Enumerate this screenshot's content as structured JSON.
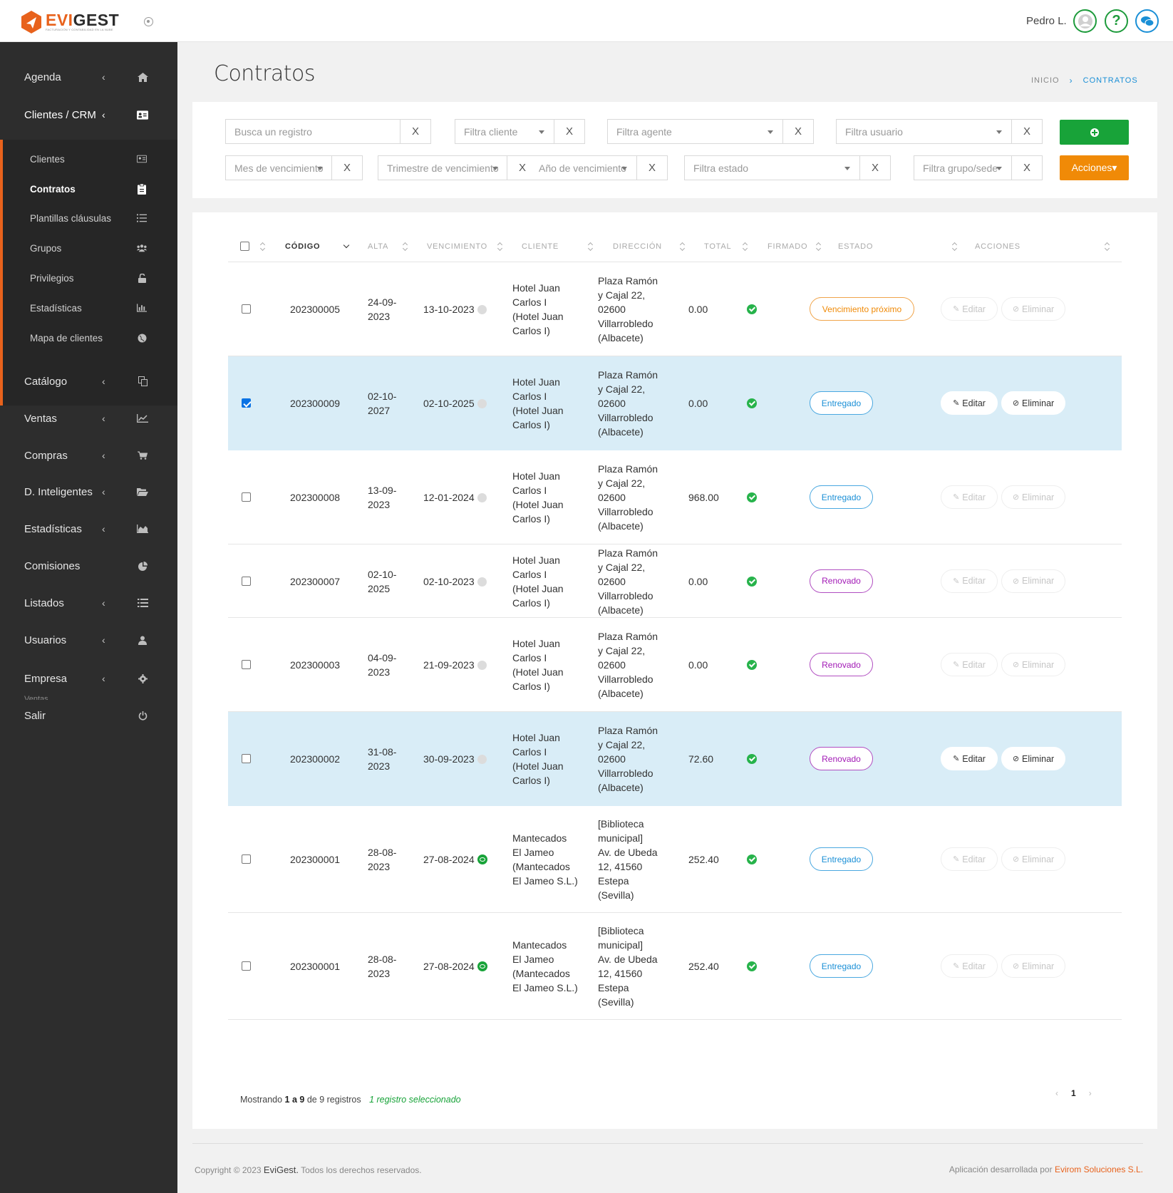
{
  "header": {
    "logo_name_a": "EVI",
    "logo_name_b": "GEST",
    "logo_tagline": "FACTURACIÓN Y CONTABILIDAD EN LA NUBE",
    "user": "Pedro L.",
    "help_glyph": "?"
  },
  "sidebar": {
    "items": [
      {
        "label": "Agenda",
        "icon": "home-icon"
      },
      {
        "label": "Clientes / CRM",
        "icon": "id-card-icon"
      },
      {
        "label": "Catálogo",
        "icon": "copy-icon"
      },
      {
        "label": "Ventas",
        "icon": "line-chart-icon"
      },
      {
        "label": "Compras",
        "icon": "cart-icon"
      },
      {
        "label": "D. Inteligentes",
        "icon": "folder-open-icon"
      },
      {
        "label": "Estadísticas",
        "icon": "area-chart-icon"
      },
      {
        "label": "Comisiones",
        "icon": "pie-chart-icon"
      },
      {
        "label": "Listados",
        "icon": "list-icon"
      },
      {
        "label": "Usuarios",
        "icon": "user-icon"
      },
      {
        "label": "Empresa",
        "icon": "gear-icon"
      },
      {
        "label": "Salir",
        "icon": "power-icon"
      }
    ],
    "chevron": "‹",
    "sub_items": [
      {
        "label": "Clientes",
        "icon": "address-card-icon"
      },
      {
        "label": "Contratos",
        "icon": "clipboard-icon",
        "active": true
      },
      {
        "label": "Plantillas cláusulas",
        "icon": "list-icon"
      },
      {
        "label": "Grupos",
        "icon": "users-icon"
      },
      {
        "label": "Privilegios",
        "icon": "unlock-icon"
      },
      {
        "label": "Estadísticas",
        "icon": "bar-chart-icon"
      },
      {
        "label": "Mapa de clientes",
        "icon": "globe-icon"
      }
    ],
    "ghost_label": "Ventas"
  },
  "page": {
    "title": "Contratos",
    "breadcrumb_home": "INICIO",
    "breadcrumb_sep": "›",
    "breadcrumb_current": "CONTRATOS"
  },
  "filters": {
    "search_placeholder": "Busca un registro",
    "clear_label": "X",
    "cliente": "Filtra cliente",
    "agente": "Filtra agente",
    "usuario": "Filtra usuario",
    "mes": "Mes de vencimiento",
    "trimestre": "Trimestre de vencimiento",
    "anio": "Año de vencimiento",
    "estado": "Filtra estado",
    "grupo": "Filtra grupo/sede",
    "acciones_label": "Acciones▾"
  },
  "table": {
    "columns": [
      "CÓDIGO",
      "ALTA",
      "VENCIMIENTO",
      "CLIENTE",
      "DIRECCIÓN",
      "TOTAL",
      "FIRMADO",
      "ESTADO",
      "ACCIONES"
    ],
    "edit_label": "Editar",
    "delete_label": "Eliminar",
    "rows": [
      {
        "codigo": "202300005",
        "alta": [
          "24-09-",
          "2023"
        ],
        "venc": "13-10-2023",
        "venc_icon": "grey-dot-icon",
        "cliente": [
          "Hotel Juan",
          "Carlos I",
          "(Hotel Juan",
          "Carlos I)"
        ],
        "dir": [
          "Plaza Ramón",
          "y Cajal 22,",
          "02600",
          "Villarrobledo",
          "(Albacete)"
        ],
        "total": "0.00",
        "estado": "Vencimiento próximo",
        "estado_color": "orange",
        "checked": false,
        "selected": false
      },
      {
        "codigo": "202300009",
        "alta": [
          "02-10-",
          "2027"
        ],
        "venc": "02-10-2025",
        "venc_icon": "grey-dot-icon",
        "cliente": [
          "Hotel Juan",
          "Carlos I",
          "(Hotel Juan",
          "Carlos I)"
        ],
        "dir": [
          "Plaza Ramón",
          "y Cajal 22,",
          "02600",
          "Villarrobledo",
          "(Albacete)"
        ],
        "total": "0.00",
        "estado": "Entregado",
        "estado_color": "blue",
        "checked": true,
        "selected": true
      },
      {
        "codigo": "202300008",
        "alta": [
          "13-09-",
          "2023"
        ],
        "venc": "12-01-2024",
        "venc_icon": "grey-dot-icon",
        "cliente": [
          "Hotel Juan",
          "Carlos I",
          "(Hotel Juan",
          "Carlos I)"
        ],
        "dir": [
          "Plaza Ramón",
          "y Cajal 22,",
          "02600",
          "Villarrobledo",
          "(Albacete)"
        ],
        "total": "968.00",
        "estado": "Entregado",
        "estado_color": "blue",
        "checked": false,
        "selected": false
      },
      {
        "codigo": "202300007",
        "alta": [
          "02-10-",
          "2025"
        ],
        "venc": "02-10-2023",
        "venc_icon": "grey-dot-icon",
        "cliente": [
          "Hotel Juan",
          "Carlos I",
          "(Hotel Juan",
          "Carlos I)"
        ],
        "dir": [
          "Plaza Ramón",
          "y Cajal 22,",
          "02600",
          "Villarrobledo",
          "(Albacete)"
        ],
        "total": "0.00",
        "estado": "Renovado",
        "estado_color": "purple",
        "checked": false,
        "selected": false
      },
      {
        "codigo": "202300003",
        "alta": [
          "04-09-",
          "2023"
        ],
        "venc": "21-09-2023",
        "venc_icon": "grey-dot-icon",
        "cliente": [
          "Hotel Juan",
          "Carlos I",
          "(Hotel Juan",
          "Carlos I)"
        ],
        "dir": [
          "Plaza Ramón",
          "y Cajal 22,",
          "02600",
          "Villarrobledo",
          "(Albacete)"
        ],
        "total": "0.00",
        "estado": "Renovado",
        "estado_color": "purple",
        "checked": false,
        "selected": false
      },
      {
        "codigo": "202300002",
        "alta": [
          "31-08-",
          "2023"
        ],
        "venc": "30-09-2023",
        "venc_icon": "grey-dot-icon",
        "cliente": [
          "Hotel Juan",
          "Carlos I",
          "(Hotel Juan",
          "Carlos I)"
        ],
        "dir": [
          "Plaza Ramón",
          "y Cajal 22,",
          "02600",
          "Villarrobledo",
          "(Albacete)"
        ],
        "total": "72.60",
        "estado": "Renovado",
        "estado_color": "purple",
        "checked": false,
        "selected": true
      },
      {
        "codigo": "202300001",
        "alta": [
          "28-08-",
          "2023"
        ],
        "venc": "27-08-2024",
        "venc_icon": "green-eye-icon",
        "cliente": [
          "Mantecados",
          "El Jameo",
          "(Mantecados",
          "El Jameo S.L.)"
        ],
        "dir": [
          "[Biblioteca",
          "municipal]",
          "Av. de Ubeda",
          "12, 41560",
          "Estepa",
          "(Sevilla)"
        ],
        "total": "252.40",
        "estado": "Entregado",
        "estado_color": "blue",
        "checked": false,
        "selected": false
      },
      {
        "codigo": "202300001",
        "alta": [
          "28-08-",
          "2023"
        ],
        "venc": "27-08-2024",
        "venc_icon": "green-eye-icon",
        "cliente": [
          "Mantecados",
          "El Jameo",
          "(Mantecados",
          "El Jameo S.L.)"
        ],
        "dir": [
          "[Biblioteca",
          "municipal]",
          "Av. de Ubeda",
          "12, 41560",
          "Estepa",
          "(Sevilla)"
        ],
        "total": "252.40",
        "estado": "Entregado",
        "estado_color": "blue",
        "checked": false,
        "selected": false
      }
    ],
    "info_prefix": "Mostrando",
    "info_range": "1 a 9",
    "info_mid": "de 9 registros",
    "selected_info": "1 registro seleccionado",
    "pager_prev": "‹",
    "pager_page": "1",
    "pager_next": "›"
  },
  "footer": {
    "copyright_a": "Copyright © 2023",
    "brand": "EviGest.",
    "copyright_b": "Todos los derechos reservados.",
    "dev_prefix": "Aplicación desarrollada por",
    "dev_company": "Evirom Soluciones S.L."
  },
  "colors": {
    "accent": "#e8621c",
    "success": "#18a339",
    "primary": "#1a8fd6",
    "warning": "#f08a07",
    "purple": "#a21ab6",
    "selected_row": "#d9edf7"
  }
}
